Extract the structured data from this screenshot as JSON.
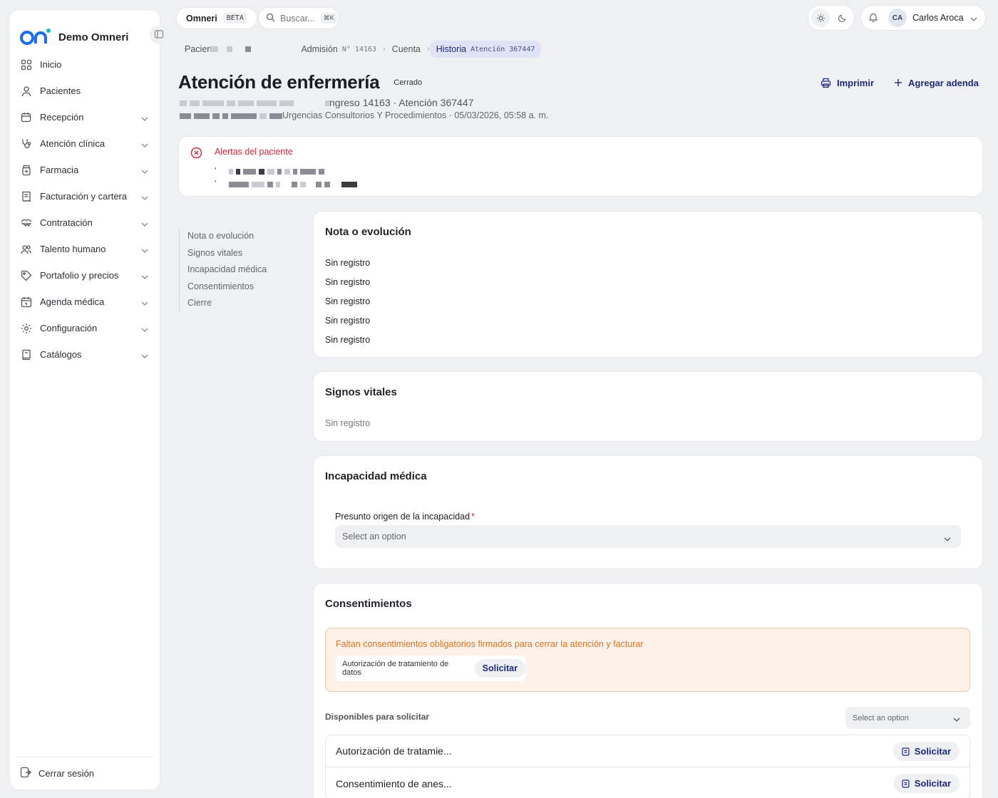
{
  "app": {
    "name": "Demo Omneri"
  },
  "sidebar": {
    "items": [
      {
        "label": "Inicio",
        "icon": "grid-icon",
        "expandable": false
      },
      {
        "label": "Pacientes",
        "icon": "person-icon",
        "expandable": false
      },
      {
        "label": "Recepción",
        "icon": "calendar-clock-icon",
        "expandable": true
      },
      {
        "label": "Atención clínica",
        "icon": "stethoscope-icon",
        "expandable": true
      },
      {
        "label": "Farmacia",
        "icon": "medicine-bottle-icon",
        "expandable": true
      },
      {
        "label": "Facturación y cartera",
        "icon": "receipt-icon",
        "expandable": true
      },
      {
        "label": "Contratación",
        "icon": "handshake-icon",
        "expandable": true
      },
      {
        "label": "Talento humano",
        "icon": "users-icon",
        "expandable": true
      },
      {
        "label": "Portafolio y precios",
        "icon": "tag-icon",
        "expandable": true
      },
      {
        "label": "Agenda médica",
        "icon": "calendar-icon",
        "expandable": true
      },
      {
        "label": "Configuración",
        "icon": "gear-icon",
        "expandable": true
      },
      {
        "label": "Catálogos",
        "icon": "book-icon",
        "expandable": true
      }
    ],
    "logout": "Cerrar sesión"
  },
  "topbar": {
    "workspace": "Omneri",
    "beta": "BETA",
    "search_placeholder": "Buscar...",
    "search_shortcut": "⌘K",
    "user_initials": "CA",
    "user_name": "Carlos Aroca"
  },
  "breadcrumb": {
    "patient": "Pacier",
    "admission_label": "Admisión",
    "admission_code": "N° 14163",
    "account": "Cuenta",
    "history_label": "Historia",
    "history_code": "Atención 367447"
  },
  "header": {
    "title": "Atención de enfermería",
    "status": "Cerrado",
    "meta_line": "ngreso 14163 · Atención 367447",
    "location_line": "Urgencias Consultorios Y Procedimientos · 05/03/2026, 05:58 a. m.",
    "print_label": "Imprimir",
    "add_agenda_label": "Agregar adenda"
  },
  "alerts": {
    "title": "Alertas del paciente"
  },
  "toc": [
    "Nota o evolución",
    "Signos vitales",
    "Incapacidad médica",
    "Consentimientos",
    "Cierre"
  ],
  "nota": {
    "title": "Nota o evolución",
    "records": [
      "Sin registro",
      "Sin registro",
      "Sin registro",
      "Sin registro",
      "Sin registro"
    ]
  },
  "signos": {
    "title": "Signos vitales",
    "empty": "Sin registro"
  },
  "incapacidad": {
    "title": "Incapacidad médica",
    "field_label": "Presunto origen de la incapacidad",
    "required_mark": "*",
    "select_placeholder": "Select an option"
  },
  "consentimientos": {
    "title": "Consentimientos",
    "warning": "Faltan consentimientos obligatorios firmados para cerrar la atención y facturar",
    "missing_item": "Autorización de tratamiento de datos",
    "request_label": "Solicitar",
    "available_label": "Disponibles para solicitar",
    "available_select_placeholder": "Select an option",
    "available": [
      {
        "name": "Autorización de tratamie...",
        "action": "Solicitar"
      },
      {
        "name": "Consentimiento de anes...",
        "action": "Solicitar"
      }
    ]
  },
  "colors": {
    "accent": "#1f2a7a",
    "danger": "#d0263b",
    "warning": "#e0731f",
    "brand": "#1a6cf0"
  }
}
